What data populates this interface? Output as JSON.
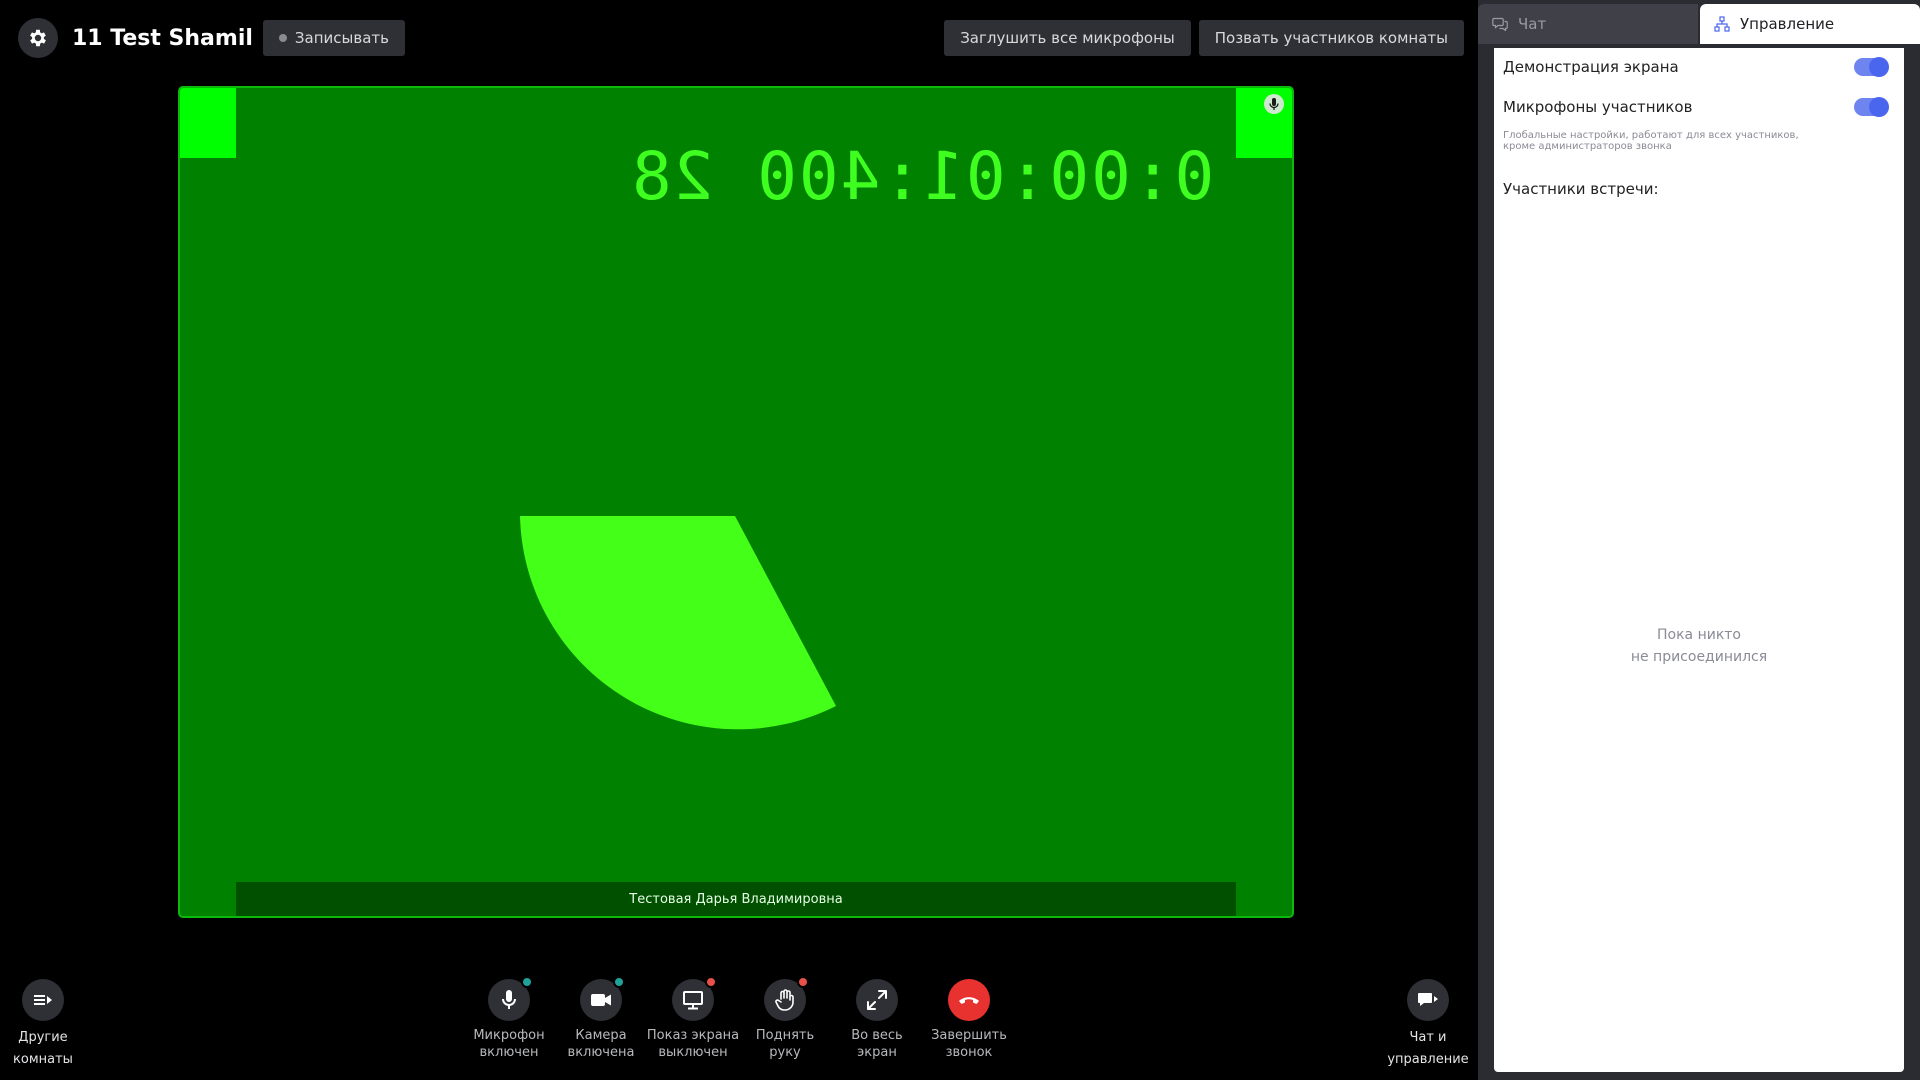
{
  "header": {
    "room_title": "11 Test Shamil",
    "record_label": "Записывать"
  },
  "top_actions": {
    "mute_all": "Заглушить все микрофоны",
    "invite": "Позвать участников комнаты"
  },
  "video": {
    "timer_text": "0:00:01:400 28",
    "participant_name": "Тестовая Дарья Владимировна",
    "background_color": "#008200"
  },
  "controls": {
    "other_rooms": "Другие\nкомнаты",
    "mic": "Микрофон\nвключен",
    "camera": "Камера\nвключена",
    "screen": "Показ экрана\nвыключен",
    "hand": "Поднять\nруку",
    "fullscreen": "Во весь\nэкран",
    "end_call": "Завершить\nзвонок",
    "chat_manage": "Чат и\nуправление"
  },
  "status_colors": {
    "on": "#1fa29a",
    "off": "#e8504a",
    "end_call": "#e8322f",
    "toggle": "#4a66ee"
  },
  "panel": {
    "tabs": {
      "chat": "Чат",
      "manage": "Управление"
    },
    "screen_share_label": "Демонстрация экрана",
    "screen_share_enabled": true,
    "mics_label": "Микрофоны участников",
    "mics_enabled": true,
    "hint": "Глобальные настройки, работают для всех участников, кроме администраторов звонка",
    "participants_label": "Участники встречи:",
    "empty_line1": "Пока никто",
    "empty_line2": "не присоединился"
  }
}
